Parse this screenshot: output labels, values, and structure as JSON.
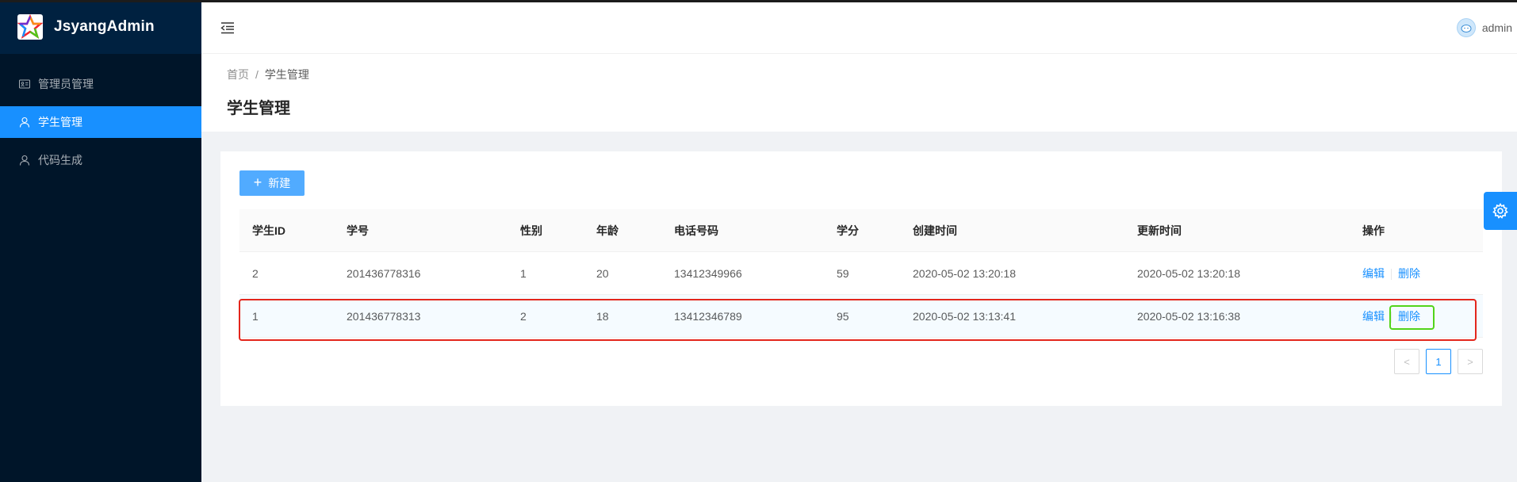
{
  "app": {
    "title": "JsyangAdmin"
  },
  "sidebar": {
    "items": [
      {
        "label": "管理员管理",
        "icon": "id-card-icon",
        "active": false
      },
      {
        "label": "学生管理",
        "icon": "user-icon",
        "active": true
      },
      {
        "label": "代码生成",
        "icon": "user-icon",
        "active": false
      }
    ]
  },
  "header": {
    "username": "admin"
  },
  "breadcrumb": {
    "home": "首页",
    "separator": "/",
    "current": "学生管理"
  },
  "page": {
    "title": "学生管理"
  },
  "toolbar": {
    "new_label": "新建"
  },
  "table": {
    "columns": [
      "学生ID",
      "学号",
      "性别",
      "年龄",
      "电话号码",
      "学分",
      "创建时间",
      "更新时间",
      "操作"
    ],
    "rows": [
      {
        "id": "2",
        "number": "201436778316",
        "gender": "1",
        "age": "20",
        "phone": "13412349966",
        "credit": "59",
        "created": "2020-05-02 13:20:18",
        "updated": "2020-05-02 13:20:18",
        "edit": "编辑",
        "delete": "删除"
      },
      {
        "id": "1",
        "number": "201436778313",
        "gender": "2",
        "age": "18",
        "phone": "13412346789",
        "credit": "95",
        "created": "2020-05-02 13:13:41",
        "updated": "2020-05-02 13:16:38",
        "edit": "编辑",
        "delete": "删除"
      }
    ]
  },
  "pagination": {
    "prev": "<",
    "current": "1",
    "next": ">"
  },
  "colors": {
    "primary": "#1890ff",
    "sider": "#001529",
    "highlight_red": "#e3261c",
    "highlight_green": "#52d41a"
  }
}
